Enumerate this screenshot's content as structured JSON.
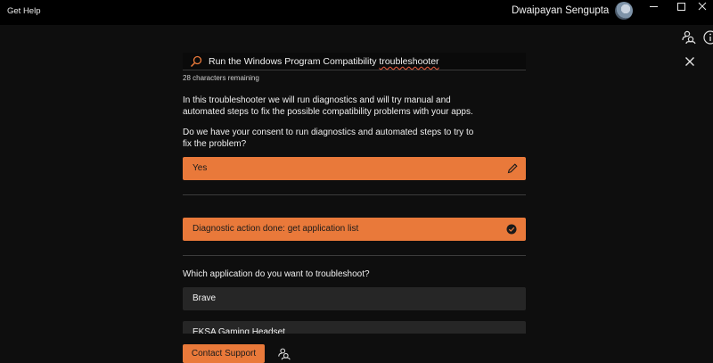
{
  "window": {
    "title": "Get Help",
    "user_name": "Dwaipayan Sengupta",
    "controls": [
      "minimize",
      "maximize",
      "close"
    ]
  },
  "toolbar": {
    "icons": [
      "community-icon",
      "info-icon"
    ]
  },
  "search": {
    "value": "Run the Windows Program Compatibility troubleshooter",
    "value_prefix": "Run the Windows Program Compatibility ",
    "value_underlined": "troubleshooter",
    "chars_remaining": "28 characters remaining"
  },
  "conversation": {
    "intro": "In this troubleshooter we will run diagnostics and will try manual and automated steps to fix the possible compatibility problems with your apps.",
    "consent_question": "Do we have your consent to run diagnostics and automated steps to try to fix the problem?",
    "answer": "Yes",
    "diagnostic_status": "Diagnostic action done: get application list",
    "app_question": "Which application do you want to troubleshoot?",
    "app_options": [
      "Brave",
      "EKSA Gaming Headset"
    ]
  },
  "footer": {
    "contact_label": "Contact Support"
  },
  "colors": {
    "accent": "#e9793a",
    "background": "#0e0e0e",
    "option_bg": "#262626"
  }
}
